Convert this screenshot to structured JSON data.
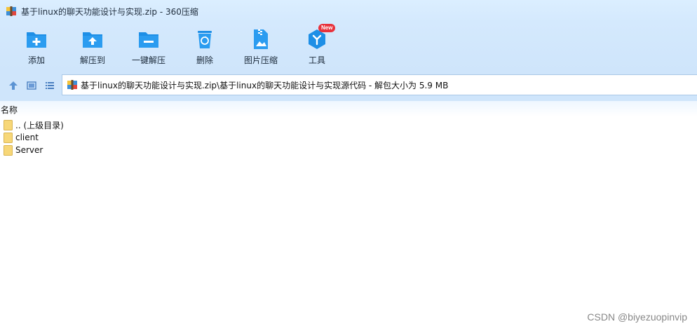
{
  "window": {
    "title": "基于linux的聊天功能设计与实现.zip - 360压缩"
  },
  "toolbar": {
    "items": [
      {
        "label": "添加",
        "icon": "folder-add-icon"
      },
      {
        "label": "解压到",
        "icon": "folder-extract-icon"
      },
      {
        "label": "一键解压",
        "icon": "folder-quick-extract-icon"
      },
      {
        "label": "删除",
        "icon": "recycle-bin-icon"
      },
      {
        "label": "图片压缩",
        "icon": "image-compress-icon"
      },
      {
        "label": "工具",
        "icon": "tools-icon",
        "badge": "New"
      }
    ]
  },
  "navbar": {
    "path": "基于linux的聊天功能设计与实现.zip\\基于linux的聊天功能设计与实现源代码 - 解包大小为 5.9 MB"
  },
  "list": {
    "column_name": "名称",
    "rows": [
      {
        "name": ".. (上级目录)"
      },
      {
        "name": "client"
      },
      {
        "name": "Server"
      }
    ]
  },
  "watermark": "CSDN @biyezuopinvip",
  "colors": {
    "toolbar_bg": "#d4e9fd",
    "icon_blue": "#1e8fe6",
    "folder_yellow": "#f7d778",
    "badge_red": "#e8323c"
  }
}
